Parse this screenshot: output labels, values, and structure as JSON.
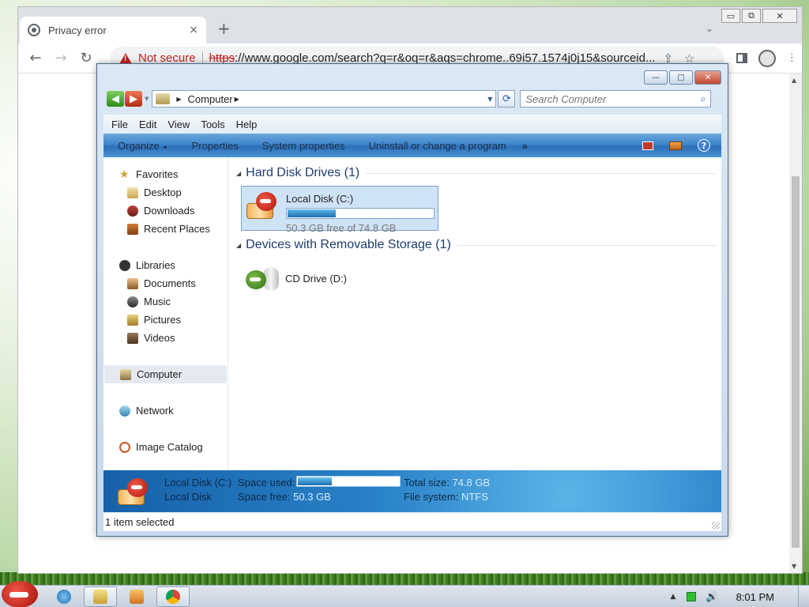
{
  "browser": {
    "tab_title": "Privacy error",
    "tab_close": "×",
    "new_tab": "+",
    "tab_search": "⌄",
    "window_buttons": {
      "minimize": "▭",
      "restore": "⧉",
      "close": "✕"
    },
    "nav": {
      "back": "←",
      "forward": "→",
      "reload": "↻"
    },
    "not_secure_label": "Not secure",
    "url_scheme": "https",
    "url_rest": "://www.google.com/search?q=r&oq=r&aqs=chrome..69i57.1574j0j15&sourceid...",
    "omnibox_icons": "⇪☆",
    "menu": "⋮"
  },
  "explorer": {
    "caption_buttons": {
      "minimize": "—",
      "maximize": "□",
      "close": "✕"
    },
    "nav_back": "◀",
    "nav_forward": "▶",
    "address_crumb": "Computer",
    "refresh": "⟳",
    "search_placeholder": "Search Computer",
    "search_icon": "⌕",
    "menu": [
      "File",
      "Edit",
      "View",
      "Tools",
      "Help"
    ],
    "commands": {
      "organize": "Organize",
      "properties": "Properties",
      "system_properties": "System properties",
      "uninstall": "Uninstall or change a program",
      "more": "»",
      "help": "?"
    },
    "nav_pane": {
      "favorites": "Favorites",
      "favorites_items": [
        "Desktop",
        "Downloads",
        "Recent Places"
      ],
      "libraries": "Libraries",
      "libraries_items": [
        "Documents",
        "Music",
        "Pictures",
        "Videos"
      ],
      "computer": "Computer",
      "network": "Network",
      "image_catalog": "Image Catalog"
    },
    "groups": {
      "hard_disk": "Hard Disk Drives (1)",
      "removable": "Devices with Removable Storage (1)"
    },
    "local_disk": {
      "name": "Local Disk (C:)",
      "free_text": "50.3 GB free of 74.8 GB",
      "used_fraction": 0.33
    },
    "cd_drive": {
      "name": "CD Drive (D:)"
    },
    "details": {
      "name": "Local Disk (C:)",
      "type": "Local Disk",
      "space_used_label": "Space used:",
      "space_free_label": "Space free:",
      "space_free_value": "50.3 GB",
      "total_size_label": "Total size:",
      "total_size_value": "74.8 GB",
      "file_system_label": "File system:",
      "file_system_value": "NTFS",
      "used_fraction": 0.33
    },
    "status": "1 item selected"
  },
  "taskbar": {
    "clock": "8:01 PM",
    "tray_up": "▲",
    "volume": "🔊"
  },
  "colors": {
    "chrome_warning": "#c5221f",
    "command_bar": "#3f86cc",
    "selection": "#cfe3f7"
  }
}
